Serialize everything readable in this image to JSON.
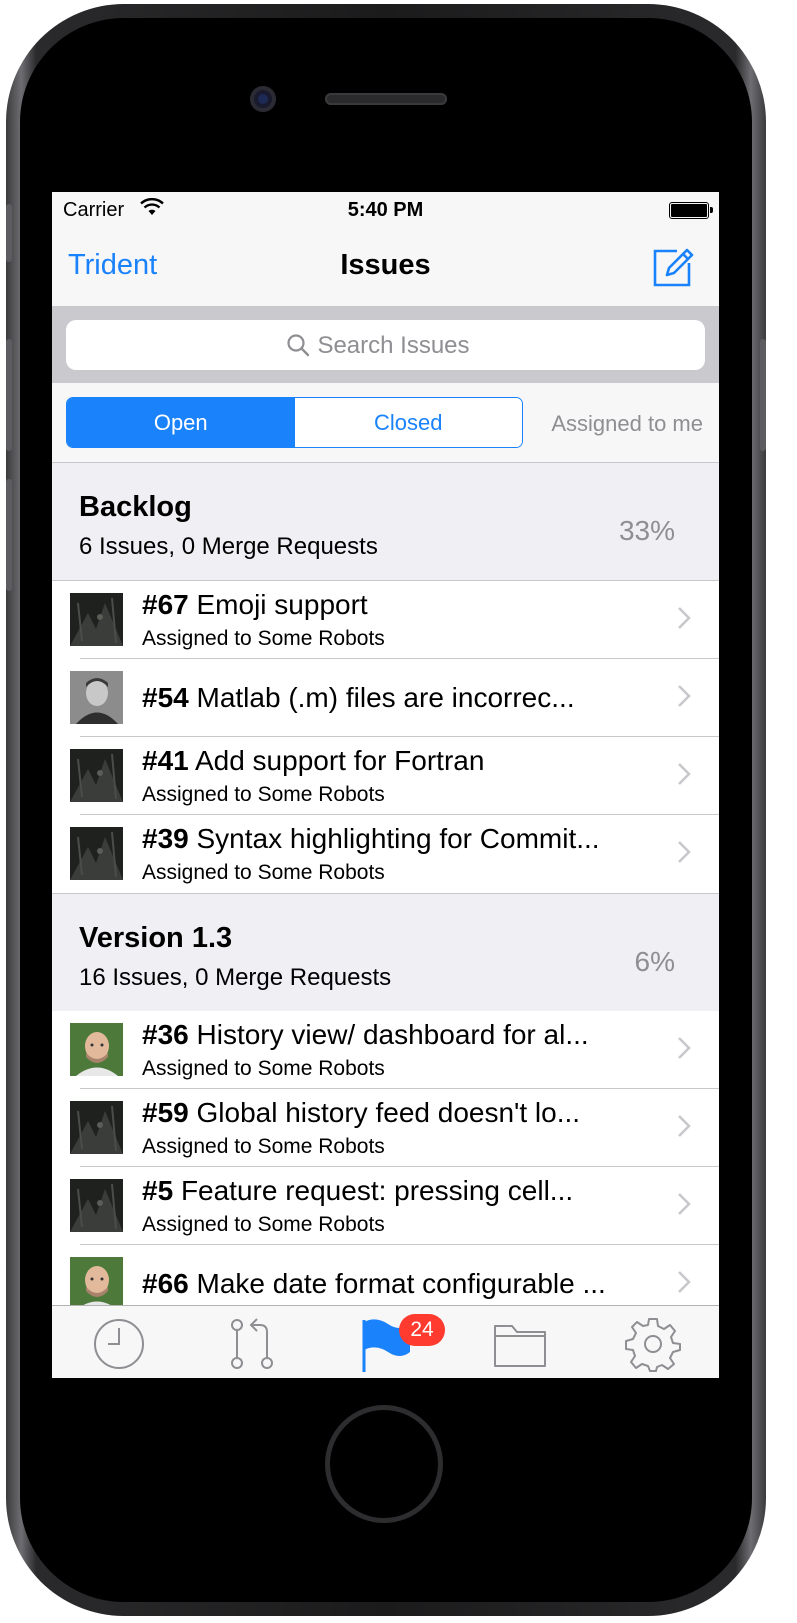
{
  "status": {
    "carrier": "Carrier",
    "time": "5:40 PM"
  },
  "nav": {
    "back_label": "Trident",
    "title": "Issues"
  },
  "search": {
    "placeholder": "Search Issues"
  },
  "filter": {
    "open": "Open",
    "closed": "Closed",
    "assigned": "Assigned to me"
  },
  "sections": [
    {
      "name": "Backlog",
      "summary": "6 Issues, 0 Merge Requests",
      "percent": "33%",
      "issues": [
        {
          "number": "#67",
          "title": "Emoji support",
          "assignee": "Assigned to Some Robots"
        },
        {
          "number": "#54",
          "title": "Matlab (.m) files are incorrec...",
          "assignee": ""
        },
        {
          "number": "#41",
          "title": "Add support for Fortran",
          "assignee": "Assigned to Some Robots"
        },
        {
          "number": "#39",
          "title": "Syntax highlighting for Commit...",
          "assignee": "Assigned to Some Robots"
        }
      ]
    },
    {
      "name": "Version 1.3",
      "summary": "16 Issues, 0 Merge Requests",
      "percent": "6%",
      "issues": [
        {
          "number": "#36",
          "title": "History view/ dashboard for al...",
          "assignee": "Assigned to Some Robots"
        },
        {
          "number": "#59",
          "title": "Global history feed doesn't lo...",
          "assignee": "Assigned to Some Robots"
        },
        {
          "number": "#5",
          "title": "Feature request: pressing cell...",
          "assignee": "Assigned to Some Robots"
        },
        {
          "number": "#66",
          "title": "Make date format configurable ...",
          "assignee": ""
        }
      ]
    }
  ],
  "tabbar": {
    "items": [
      "clock-icon",
      "merge-request-icon",
      "flag-icon",
      "folder-icon",
      "gear-icon"
    ],
    "badge": "24"
  },
  "colors": {
    "accent": "#1a82fb",
    "badge": "#ff3b30"
  }
}
